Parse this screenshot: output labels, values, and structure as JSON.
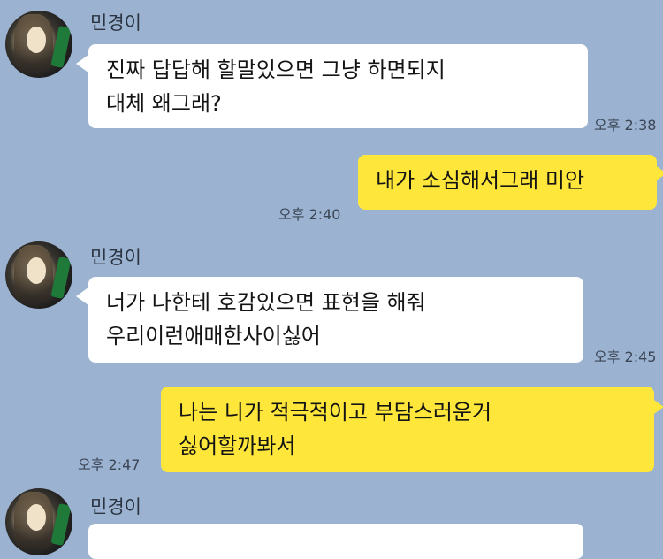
{
  "messages": [
    {
      "sender": "민경이",
      "lines": [
        "진짜 답답해 할말있으면 그냥 하면되지",
        "대체 왜그래?"
      ],
      "time": "오후 2:38"
    },
    {
      "sender": "me",
      "lines": [
        "내가 소심해서그래 미안"
      ],
      "time": "오후 2:40"
    },
    {
      "sender": "민경이",
      "lines": [
        "너가 나한테 호감있으면 표현을 해줘",
        "우리이런애매한사이싫어"
      ],
      "time": "오후 2:45"
    },
    {
      "sender": "me",
      "lines": [
        "나는 니가 적극적이고 부담스러운거",
        "싫어할까봐서"
      ],
      "time": "오후 2:47"
    },
    {
      "sender": "민경이",
      "lines": []
    }
  ],
  "colors": {
    "background": "#9bb3d1",
    "incoming_bubble": "#ffffff",
    "outgoing_bubble": "#fee73a"
  }
}
